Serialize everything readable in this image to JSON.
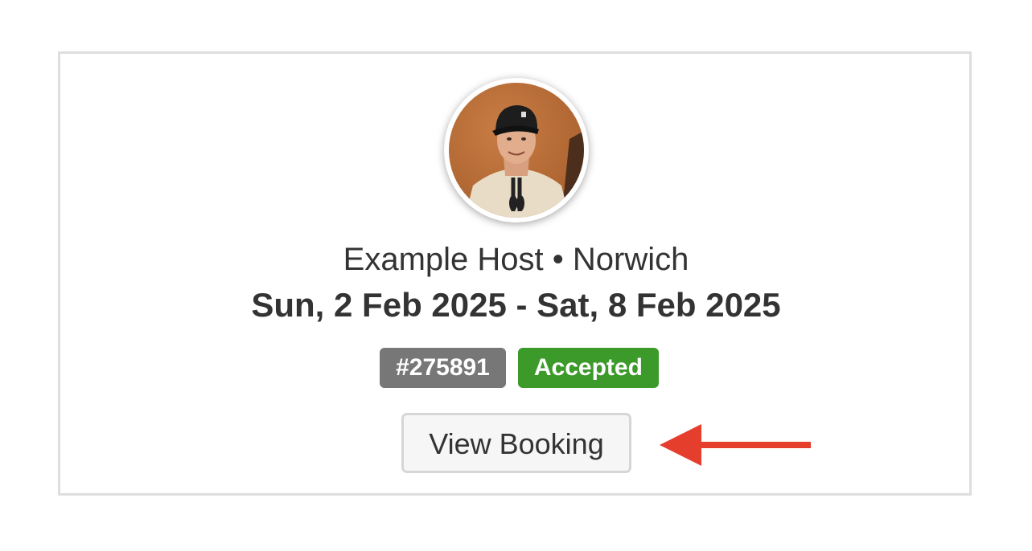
{
  "booking": {
    "host_line": "Example Host • Norwich",
    "dates": "Sun, 2 Feb 2025 - Sat, 8 Feb 2025",
    "booking_id": "#275891",
    "status": "Accepted",
    "view_button_label": "View Booking"
  },
  "colors": {
    "status_badge": "#3c9a2b",
    "id_badge": "#777777",
    "annotation_arrow": "#e53e2c",
    "card_border": "#dedede",
    "text": "#333333"
  },
  "icons": {
    "avatar": "host-avatar-photo",
    "annotation": "arrow-left-icon"
  }
}
